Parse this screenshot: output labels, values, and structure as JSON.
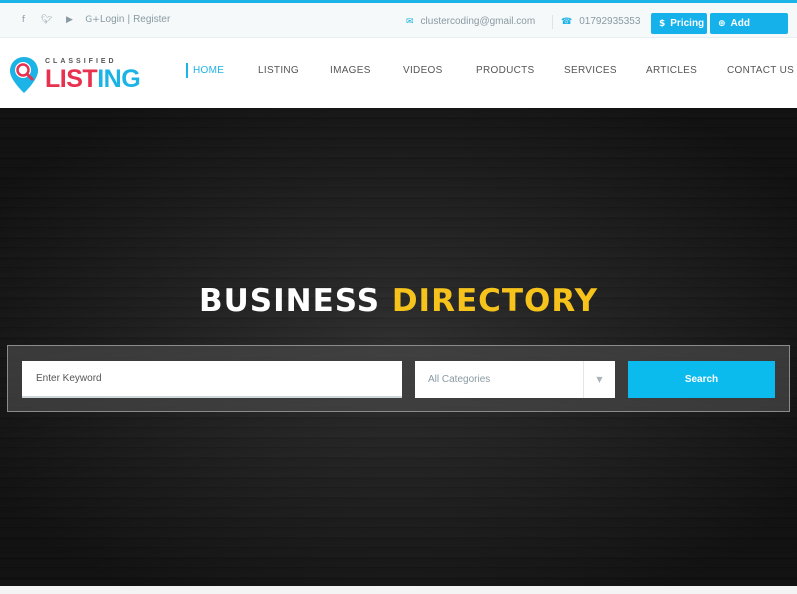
{
  "topbar": {
    "social_icons": [
      {
        "name": "facebook-icon",
        "glyph": "f"
      },
      {
        "name": "twitter-icon",
        "glyph": "♥"
      },
      {
        "name": "youtube-icon",
        "glyph": "▶"
      },
      {
        "name": "google-plus-icon",
        "glyph": "G+"
      }
    ],
    "login": "Login",
    "separator": "|",
    "register": "Register",
    "email": "clustercoding@gmail.com",
    "phone": "01792935353",
    "pricing_label": "Pricing",
    "add_listing_label": "Add Listing",
    "accent_color": "#1cb3e6"
  },
  "logo": {
    "small_text": "CLASSIFIED",
    "big_text_a": "L",
    "big_text_b": "IST",
    "big_text_c": "ING",
    "brand_red": "#e8304f",
    "brand_blue": "#1cb3e6"
  },
  "nav": {
    "items": [
      "HOME",
      "LISTING",
      "IMAGES",
      "VIDEOS",
      "PRODUCTS",
      "SERVICES",
      "ARTICLES",
      "CONTACT US"
    ],
    "active": "HOME"
  },
  "hero": {
    "title_white": "BUSINESS",
    "title_yellow": "DIRECTORY",
    "keyword_placeholder": "Enter Keyword",
    "category_selected": "All Categories",
    "search_label": "Search",
    "highlight_color": "#f6c21c"
  }
}
